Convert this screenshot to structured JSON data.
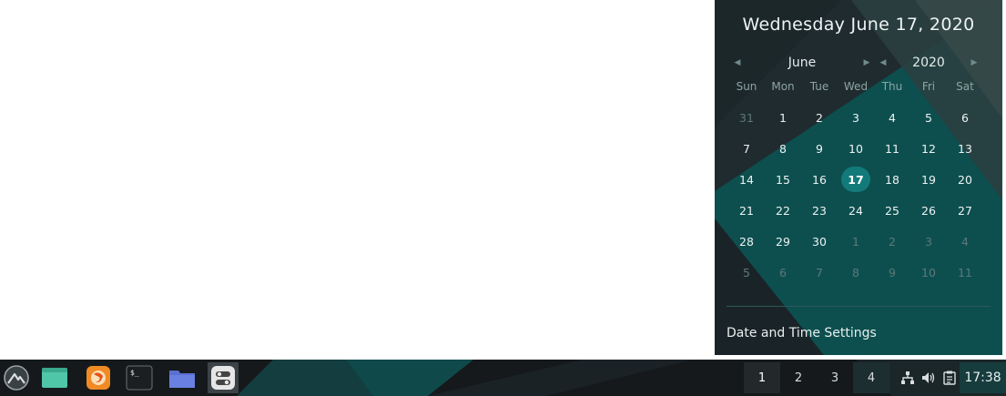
{
  "calendar": {
    "header": "Wednesday June 17, 2020",
    "month": "June",
    "year": "2020",
    "weekdays": [
      "Sun",
      "Mon",
      "Tue",
      "Wed",
      "Thu",
      "Fri",
      "Sat"
    ],
    "days": [
      {
        "d": "31",
        "muted": true
      },
      {
        "d": "1"
      },
      {
        "d": "2"
      },
      {
        "d": "3"
      },
      {
        "d": "4"
      },
      {
        "d": "5"
      },
      {
        "d": "6"
      },
      {
        "d": "7"
      },
      {
        "d": "8"
      },
      {
        "d": "9"
      },
      {
        "d": "10"
      },
      {
        "d": "11"
      },
      {
        "d": "12"
      },
      {
        "d": "13"
      },
      {
        "d": "14"
      },
      {
        "d": "15"
      },
      {
        "d": "16"
      },
      {
        "d": "17",
        "today": true
      },
      {
        "d": "18"
      },
      {
        "d": "19"
      },
      {
        "d": "20"
      },
      {
        "d": "21"
      },
      {
        "d": "22"
      },
      {
        "d": "23"
      },
      {
        "d": "24"
      },
      {
        "d": "25"
      },
      {
        "d": "26"
      },
      {
        "d": "27"
      },
      {
        "d": "28"
      },
      {
        "d": "29"
      },
      {
        "d": "30"
      },
      {
        "d": "1",
        "muted": true
      },
      {
        "d": "2",
        "muted": true
      },
      {
        "d": "3",
        "muted": true
      },
      {
        "d": "4",
        "muted": true
      },
      {
        "d": "5",
        "muted": true
      },
      {
        "d": "6",
        "muted": true
      },
      {
        "d": "7",
        "muted": true
      },
      {
        "d": "8",
        "muted": true
      },
      {
        "d": "9",
        "muted": true
      },
      {
        "d": "10",
        "muted": true
      },
      {
        "d": "11",
        "muted": true
      }
    ],
    "settings_label": "Date and Time Settings",
    "accent": "#137a7a"
  },
  "taskbar": {
    "apps": [
      {
        "name": "menu-icon"
      },
      {
        "name": "files-window-icon"
      },
      {
        "name": "firefox-icon"
      },
      {
        "name": "terminal-icon"
      },
      {
        "name": "folder-icon"
      },
      {
        "name": "settings-toggle-icon"
      }
    ],
    "workspaces": [
      "1",
      "2",
      "3",
      "4"
    ],
    "current_workspace": "1",
    "tray": [
      "network-icon",
      "volume-icon",
      "clipboard-icon"
    ],
    "clock": "17:38"
  }
}
